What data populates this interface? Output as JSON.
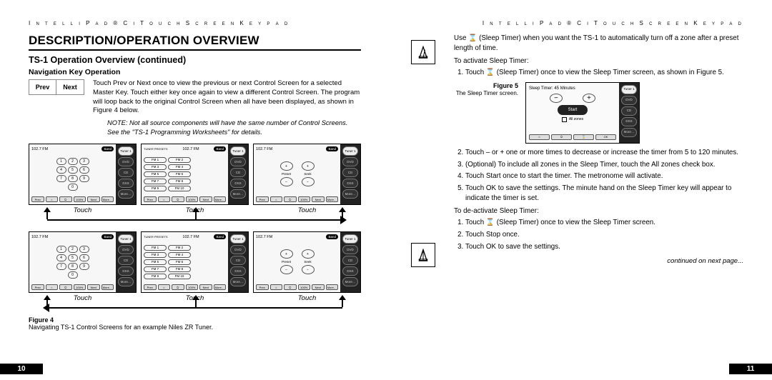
{
  "running_head": "I n t e l l i P a d ® C i T o u c h S c r e e n K e y p a d",
  "left": {
    "h1": "DESCRIPTION/OPERATION OVERVIEW",
    "h2": "TS-1 Operation Overview (continued)",
    "h3": "Navigation Key Operation",
    "prev": "Prev",
    "next": "Next",
    "nav_para": "Touch Prev or Next once to view the previous or next Control Screen for a selected Master Key. Touch either key once again to view a different Control Screen. The program will loop back to the original Control Screen when all have been displayed, as shown in Figure 4 below.",
    "note": "NOTE: Not all source components will have the same number of Control Screens. See the \"TS-1 Programming Worksheets\" for details.",
    "freq": "102.7 FM",
    "band": "Band",
    "tuner_presets": "TUNER PRESETS",
    "fm_presets": [
      "FM 1",
      "FM 2",
      "FM 3",
      "FM 4",
      "FM 5",
      "FM 6",
      "FM 7",
      "FM 8",
      "FM 9",
      "FM 10"
    ],
    "seek_preset": "Preset",
    "seek_seek": "Seek",
    "side": [
      "Tuner 1",
      "DVD",
      "CD",
      "DSS",
      "More…"
    ],
    "bottom": [
      "Prev",
      "⌂",
      "⏻",
      "100%",
      "Next",
      "More…"
    ],
    "touch": "Touch",
    "fig4_label": "Figure 4",
    "fig4_caption": "Navigating TS-1 Control Screens for an example Niles ZR Tuner.",
    "page_num": "10"
  },
  "right": {
    "intro": "Use ⌛ (Sleep Timer) when you want the TS-1 to automatically turn off a zone after a preset length of time.",
    "to_activate": "To activate Sleep Timer:",
    "steps_activate": [
      "Touch ⌛ (Sleep Timer) once to view the Sleep Timer screen, as shown in Figure 5.",
      "Touch – or + one or more times to decrease or increase the timer from 5 to 120 minutes.",
      "(Optional) To include all zones in the Sleep Timer, touch the All zones check box.",
      "Touch Start once to start the timer. The metronome will activate.",
      "Touch OK to save the settings. The minute hand on the Sleep Timer key will appear to indicate the timer is set."
    ],
    "to_deactivate": "To de-activate Sleep Timer:",
    "steps_deactivate": [
      "Touch ⌛ (Sleep Timer) once to view the Sleep Timer screen.",
      "Touch Stop once.",
      "Touch OK to save the settings."
    ],
    "fig5_label": "Figure 5",
    "fig5_caption": "The Sleep Timer screen.",
    "sleep_title": "Sleep Timer: 45 Minutes",
    "sleep_start": "Start",
    "sleep_allzones": "All zones",
    "cont": "continued on next page...",
    "page_num": "11"
  }
}
